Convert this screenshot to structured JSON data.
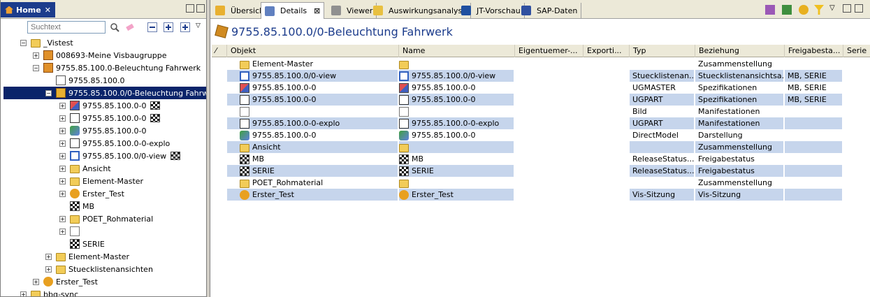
{
  "left_panel": {
    "tab_title": "Home",
    "search_placeholder": "Suchtext",
    "tree": [
      {
        "label": "_Vistest",
        "icon": "folder-icon",
        "expander": "−",
        "flag": false
      },
      {
        "label": "008693-Meine Visbaugruppe",
        "icon": "assembly-icon",
        "expander": "+",
        "flag": false
      },
      {
        "label": "9755.85.100.0-Beleuchtung Fahrwerk",
        "icon": "assembly-icon",
        "expander": "−",
        "flag": false
      },
      {
        "label": "9755.85.100.0",
        "icon": "document-icon",
        "expander": "",
        "flag": false
      },
      {
        "label": "9755.85.100.0/0-Beleuchtung Fahrw",
        "icon": "assembly-gold-icon",
        "expander": "−",
        "flag": false
      },
      {
        "label": "9755.85.100.0-0",
        "icon": "ugmaster-icon",
        "expander": "+",
        "flag": true
      },
      {
        "label": "9755.85.100.0-0",
        "icon": "ugpart-icon",
        "expander": "+",
        "flag": true
      },
      {
        "label": "9755.85.100.0-0",
        "icon": "directmodel-icon",
        "expander": "+",
        "flag": false
      },
      {
        "label": "9755.85.100.0-0-explo",
        "icon": "ugpart-icon",
        "expander": "+",
        "flag": false
      },
      {
        "label": "9755.85.100.0/0-view",
        "icon": "bomview-icon",
        "expander": "+",
        "flag": true
      },
      {
        "label": "Ansicht",
        "icon": "folder-icon",
        "expander": "+",
        "flag": false
      },
      {
        "label": "Element-Master",
        "icon": "folder-icon",
        "expander": "+",
        "flag": false
      },
      {
        "label": "Erster_Test",
        "icon": "vis-session-icon",
        "expander": "+",
        "flag": false
      },
      {
        "label": "MB",
        "icon": "release-flag-icon",
        "expander": "",
        "flag": false
      },
      {
        "label": "POET_Rohmaterial",
        "icon": "folder-icon",
        "expander": "+",
        "flag": false
      },
      {
        "label": "",
        "icon": "image-icon",
        "expander": "+",
        "flag": false
      },
      {
        "label": "SERIE",
        "icon": "release-flag-icon",
        "expander": "",
        "flag": false
      },
      {
        "label": "Element-Master",
        "icon": "folder-icon",
        "expander": "+",
        "flag": false
      },
      {
        "label": "Stuecklistenansichten",
        "icon": "folder-icon",
        "expander": "+",
        "flag": false
      },
      {
        "label": "Erster_Test",
        "icon": "vis-session-icon",
        "expander": "+",
        "flag": false
      },
      {
        "label": "bbg-sync",
        "icon": "folder-icon",
        "expander": "+",
        "flag": false
      }
    ]
  },
  "right_panel": {
    "tabs": [
      {
        "label": "Übersicht",
        "icon": "overview-icon",
        "active": false
      },
      {
        "label": "Details",
        "icon": "details-icon",
        "active": true,
        "closable": "⊠"
      },
      {
        "label": "Viewer",
        "icon": "viewer-icon",
        "active": false
      },
      {
        "label": "Auswirkungsanalyse",
        "icon": "impact-icon",
        "active": false
      },
      {
        "label": "JT-Vorschau",
        "icon": "jt-icon",
        "active": false
      },
      {
        "label": "SAP-Daten",
        "icon": "sap-icon",
        "active": false
      }
    ],
    "title": "9755.85.100.0/0-Beleuchtung Fahrwerk",
    "columns": [
      "⁄",
      "Objekt",
      "Name",
      "Eigentuemer-...",
      "Exporti...",
      "Typ",
      "Beziehung",
      "Freigabesta...",
      "Serie"
    ],
    "rows": [
      {
        "objekt": "Element-Master",
        "icon": "folder-icon",
        "name": "",
        "typ": "",
        "beziehung": "Zusammenstellung",
        "freigabe": "",
        "hl": false
      },
      {
        "objekt": "9755.85.100.0/0-view",
        "icon": "bomview-icon",
        "name": "9755.85.100.0/0-view",
        "typ": "Stuecklistenan...",
        "beziehung": "Stuecklistenansichtsa...",
        "freigabe": "MB, SERIE",
        "hl": true
      },
      {
        "objekt": "9755.85.100.0-0",
        "icon": "ugmaster-icon",
        "name": "9755.85.100.0-0",
        "typ": "UGMASTER",
        "beziehung": "Spezifikationen",
        "freigabe": "MB, SERIE",
        "hl": false
      },
      {
        "objekt": "9755.85.100.0-0",
        "icon": "ugpart-icon",
        "name": "9755.85.100.0-0",
        "typ": "UGPART",
        "beziehung": "Spezifikationen",
        "freigabe": "MB, SERIE",
        "hl": true
      },
      {
        "objekt": "",
        "icon": "image-icon",
        "name": "",
        "typ": "Bild",
        "beziehung": "Manifestationen",
        "freigabe": "",
        "hl": false
      },
      {
        "objekt": "9755.85.100.0-0-explo",
        "icon": "ugpart-icon",
        "name": "9755.85.100.0-0-explo",
        "typ": "UGPART",
        "beziehung": "Manifestationen",
        "freigabe": "",
        "hl": true
      },
      {
        "objekt": "9755.85.100.0-0",
        "icon": "directmodel-icon",
        "name": "9755.85.100.0-0",
        "typ": "DirectModel",
        "beziehung": "Darstellung",
        "freigabe": "",
        "hl": false
      },
      {
        "objekt": "Ansicht",
        "icon": "folder-icon",
        "name": "",
        "typ": "",
        "beziehung": "Zusammenstellung",
        "freigabe": "",
        "hl": true
      },
      {
        "objekt": "MB",
        "icon": "release-flag-icon",
        "name": "MB",
        "typ": "ReleaseStatus...",
        "beziehung": "Freigabestatus",
        "freigabe": "",
        "hl": false
      },
      {
        "objekt": "SERIE",
        "icon": "release-flag-icon",
        "name": "SERIE",
        "typ": "ReleaseStatus...",
        "beziehung": "Freigabestatus",
        "freigabe": "",
        "hl": true
      },
      {
        "objekt": "POET_Rohmaterial",
        "icon": "folder-icon",
        "name": "",
        "typ": "",
        "beziehung": "Zusammenstellung",
        "freigabe": "",
        "hl": false
      },
      {
        "objekt": "Erster_Test",
        "icon": "vis-session-icon",
        "name": "Erster_Test",
        "typ": "Vis-Sitzung",
        "beziehung": "Vis-Sitzung",
        "freigabe": "",
        "hl": true
      }
    ]
  },
  "colors": {
    "selection": "#0a246a",
    "row_highlight": "#c6d5ec",
    "title": "#1c3c8c"
  }
}
